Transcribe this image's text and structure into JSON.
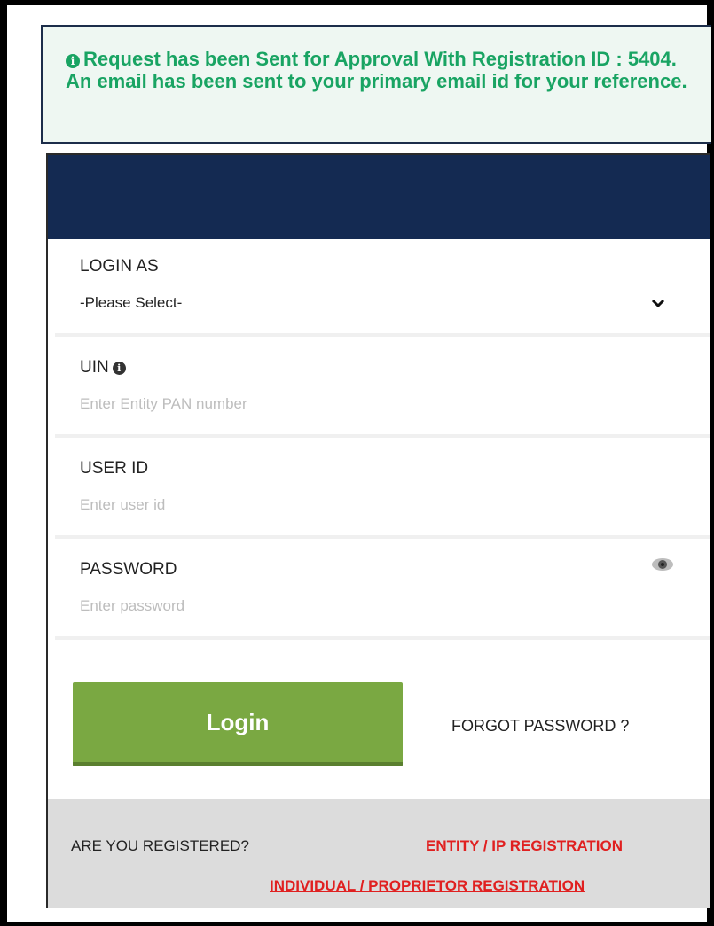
{
  "alert": {
    "message": "Request has been Sent for Approval With Registration ID : 5404. An email has been sent to your primary email id for your reference.",
    "color": "#19a463"
  },
  "header": {
    "color": "#142a52"
  },
  "fields": {
    "login_as": {
      "label": "LOGIN AS",
      "value": "-Please Select-"
    },
    "uin": {
      "label": "UIN",
      "placeholder": "Enter Entity PAN number"
    },
    "user_id": {
      "label": "USER ID",
      "placeholder": "Enter user id"
    },
    "password": {
      "label": "PASSWORD",
      "placeholder": "Enter password"
    }
  },
  "actions": {
    "login_label": "Login",
    "forgot_label": "FORGOT PASSWORD ?",
    "login_color": "#7aa842"
  },
  "footer": {
    "question": "ARE YOU REGISTERED?",
    "entity_link": "ENTITY / IP REGISTRATION",
    "individual_link": "INDIVIDUAL / PROPRIETOR REGISTRATION",
    "link_color": "#e02020"
  },
  "icons": [
    "info-icon",
    "chevron-down-icon",
    "eye-icon"
  ]
}
